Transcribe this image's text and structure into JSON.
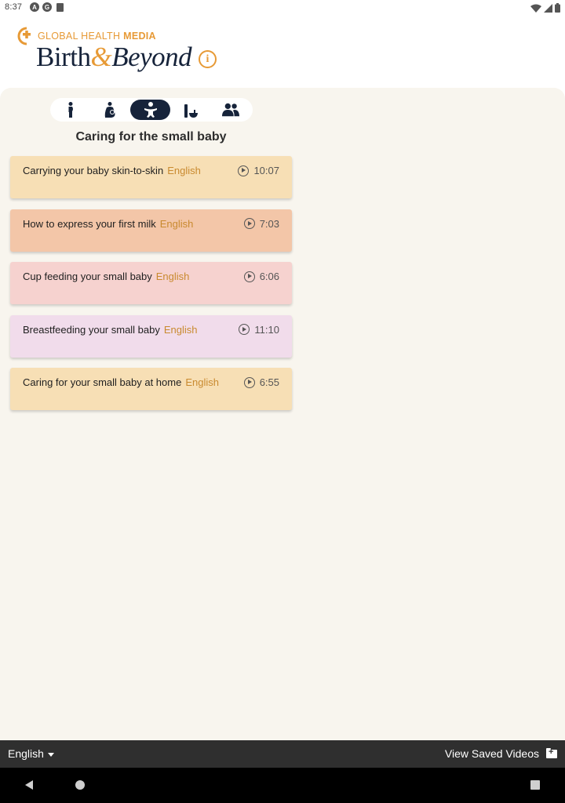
{
  "status_bar": {
    "time": "8:37",
    "notification_icons": [
      "a-circle-icon",
      "g-circle-icon",
      "sd-card-icon"
    ],
    "system_icons": [
      "wifi-icon",
      "signal-icon",
      "battery-icon"
    ]
  },
  "header": {
    "brand_prefix": "GLOBAL HEALTH",
    "brand_suffix": "MEDIA",
    "app_title_part1": "Birth",
    "app_title_amp": "&",
    "app_title_part2": "Beyond",
    "info_icon": "i",
    "accent_color": "#e79a36",
    "navy_color": "#16233a"
  },
  "tabs": [
    {
      "name": "pregnancy",
      "icon": "pregnant-woman-icon",
      "active": false
    },
    {
      "name": "breastfeeding",
      "icon": "mother-baby-icon",
      "active": false
    },
    {
      "name": "small-baby",
      "icon": "baby-icon",
      "active": true
    },
    {
      "name": "newborn-care",
      "icon": "bottle-bowl-icon",
      "active": false
    },
    {
      "name": "family",
      "icon": "people-icon",
      "active": false
    }
  ],
  "section_title": "Caring for the small baby",
  "videos": [
    {
      "title": "Carrying your baby skin-to-skin",
      "language": "English",
      "duration": "10:07",
      "color": "#f7dfb5"
    },
    {
      "title": "How to express your first milk",
      "language": "English",
      "duration": "7:03",
      "color": "#f3c6a8"
    },
    {
      "title": "Cup feeding your small baby",
      "language": "English",
      "duration": "6:06",
      "color": "#f6d2cf"
    },
    {
      "title": "Breastfeeding your small baby",
      "language": "English",
      "duration": "11:10",
      "color": "#f1dceb"
    },
    {
      "title": "Caring for your small baby at home",
      "language": "English",
      "duration": "6:55",
      "color": "#f7dfb5"
    }
  ],
  "bottom_bar": {
    "language": "English",
    "saved_videos_label": "View Saved Videos"
  }
}
